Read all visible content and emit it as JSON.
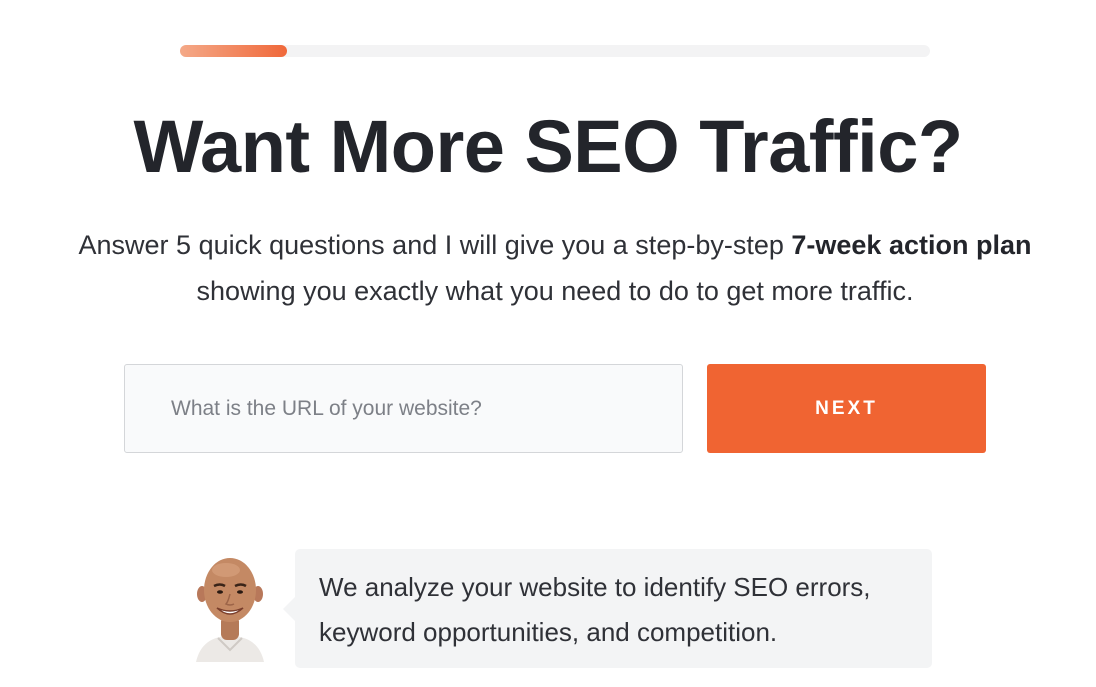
{
  "progress": {
    "step": 1,
    "total_steps": 7,
    "fraction": 0.143,
    "fill_color": "#f0683a",
    "track_color": "#f3f3f4"
  },
  "headline": "Want More SEO Traffic?",
  "subtitle": {
    "lead": "Answer 5 quick questions and I will give you a step-by-step ",
    "emphasis": "7-week action plan",
    "tail": "showing you exactly what you need to do to get more traffic."
  },
  "form": {
    "url_value": "",
    "url_placeholder": "What is the URL of your website?",
    "next_label": "NEXT",
    "accent_color": "#f06432"
  },
  "testimonial": {
    "avatar_icon": "person-avatar-icon",
    "text": "We analyze your website to identify SEO errors, keyword opportunities, and competition."
  }
}
